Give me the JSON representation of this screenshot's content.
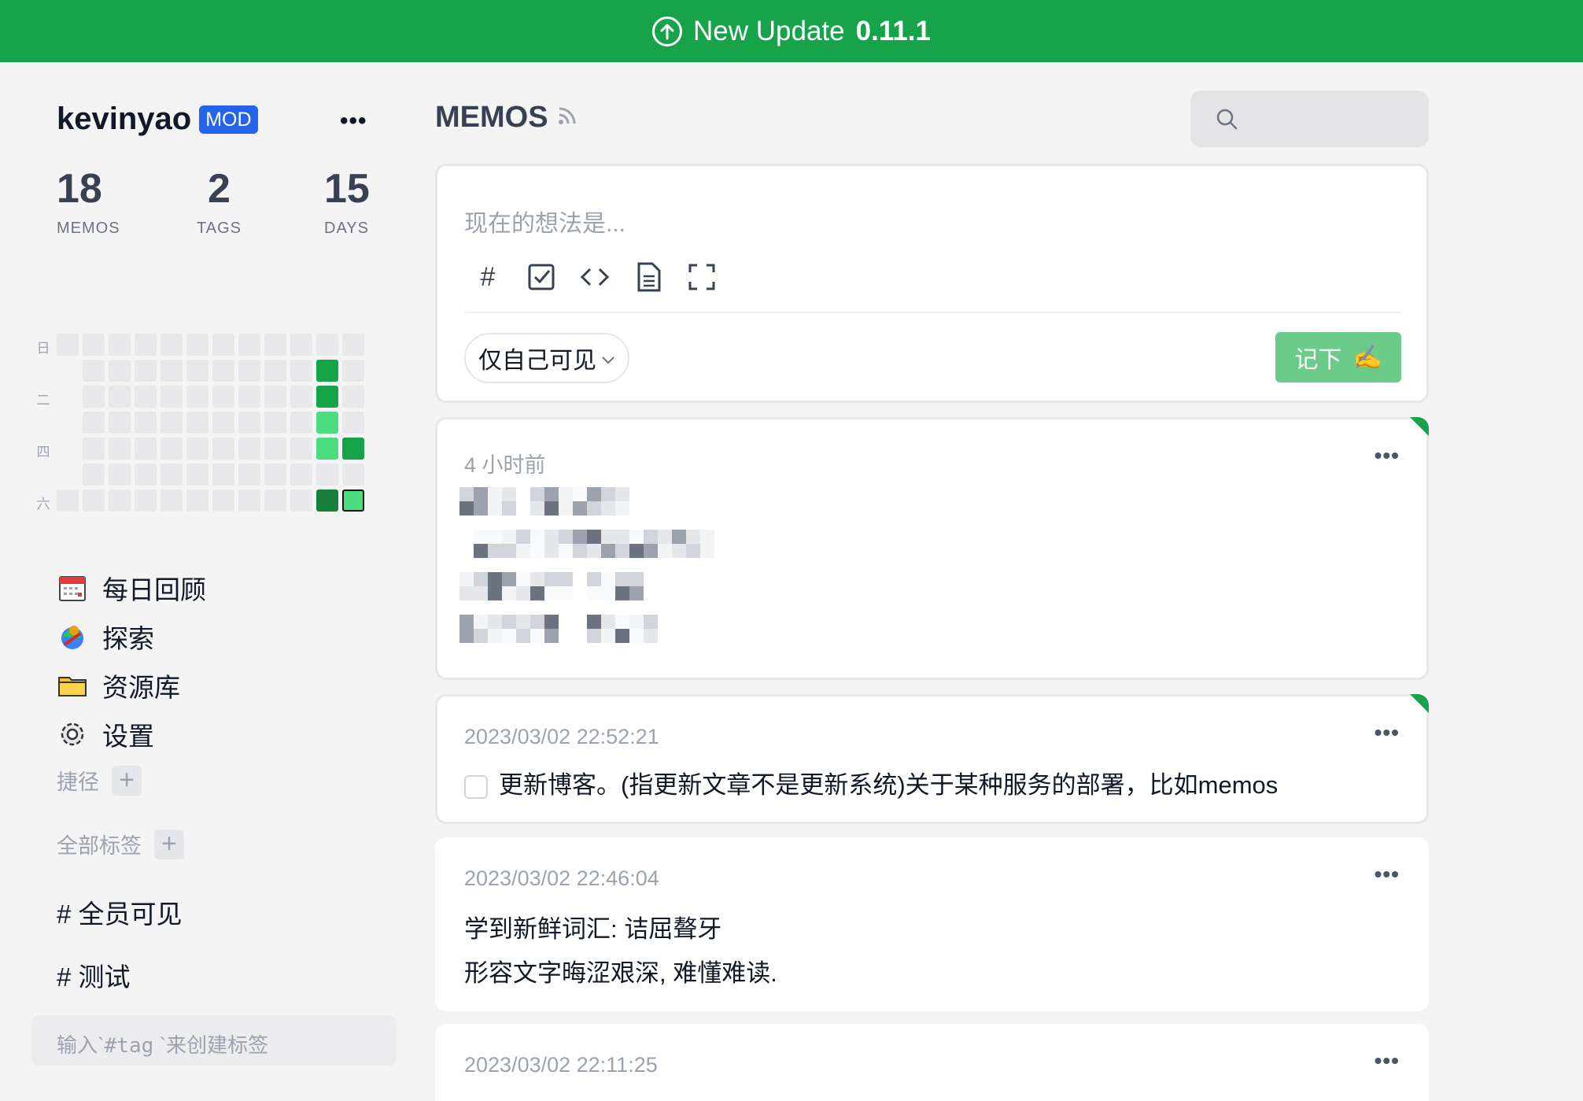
{
  "banner": {
    "text": "New Update",
    "version": "0.11.1"
  },
  "user": {
    "name": "kevinyao",
    "badge": "MOD",
    "menu": "•••"
  },
  "stats": [
    {
      "value": "18",
      "label": "MEMOS"
    },
    {
      "value": "2",
      "label": "TAGS"
    },
    {
      "value": "15",
      "label": "DAYS"
    }
  ],
  "heatmap": {
    "day_labels": [
      "日",
      "二",
      "四",
      "六"
    ],
    "weeks": 12,
    "active": [
      {
        "week": 10,
        "day": 1,
        "level": 2
      },
      {
        "week": 10,
        "day": 2,
        "level": 2
      },
      {
        "week": 10,
        "day": 3,
        "level": 1
      },
      {
        "week": 10,
        "day": 4,
        "level": 1
      },
      {
        "week": 11,
        "day": 4,
        "level": 2
      },
      {
        "week": 10,
        "day": 6,
        "level": 3
      },
      {
        "week": 11,
        "day": 6,
        "level": 1,
        "today": true
      }
    ]
  },
  "nav": [
    {
      "label": "每日回顾",
      "icon": "calendar-icon"
    },
    {
      "label": "探索",
      "icon": "explore-icon"
    },
    {
      "label": "资源库",
      "icon": "folder-icon"
    },
    {
      "label": "设置",
      "icon": "gear-icon"
    }
  ],
  "shortcuts_label": "捷径",
  "all_tags_label": "全部标签",
  "tags": [
    "# 全员可见",
    "# 测试"
  ],
  "tag_hint": {
    "prefix": "输入`",
    "code": "#tag",
    "suffix": " `来创建标签"
  },
  "page": {
    "title": "MEMOS",
    "rss_icon": "rss-icon"
  },
  "search": {
    "placeholder": ""
  },
  "editor": {
    "placeholder": "现在的想法是...",
    "tools": [
      "#",
      "checkbox-icon",
      "code-icon",
      "file-icon",
      "fullscreen-icon"
    ],
    "visibility": "仅自己可见",
    "save_label": "记下",
    "save_emoji": "✍️"
  },
  "memos": [
    {
      "time": "4 小时前",
      "pinned": true,
      "blurred": true
    },
    {
      "time": "2023/03/02 22:52:21",
      "pinned": true,
      "lines": [
        "更新博客。(指更新文章不是更新系统)关于某种服务的部署，比如memos"
      ],
      "checkbox": true
    },
    {
      "time": "2023/03/02 22:46:04",
      "pinned": false,
      "lines": [
        "学到新鲜词汇: 诘屈聱牙",
        "形容文字晦涩艰深, 难懂难读."
      ]
    },
    {
      "time": "2023/03/02 22:11:25",
      "pinned": false,
      "lines": []
    }
  ],
  "colors": {
    "brand": "#16a34a",
    "badge": "#2563eb",
    "save": "#6ccb8a"
  }
}
